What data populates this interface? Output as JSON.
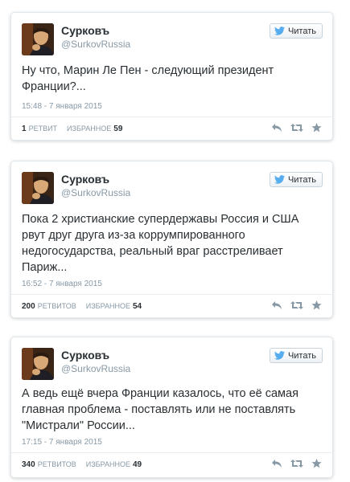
{
  "tweets": [
    {
      "name": "Сурковъ",
      "handle": "@SurkovRussia",
      "follow_label": "Читать",
      "text": "Ну что, Марин Ле Пен - следующий президент Франции?...",
      "time": "15:48 - 7 января 2015",
      "retweets_count": "1",
      "retweets_label": "ретвит",
      "favorites_label": "избранное",
      "favorites_count": "59"
    },
    {
      "name": "Сурковъ",
      "handle": "@SurkovRussia",
      "follow_label": "Читать",
      "text": "Пока 2 христианские супердержавы Россия и США рвут друг друга из-за коррумпированного недогосударства, реальный враг расстреливает Париж...",
      "time": "16:52 - 7 января 2015",
      "retweets_count": "200",
      "retweets_label": "ретвитов",
      "favorites_label": "избранное",
      "favorites_count": "54"
    },
    {
      "name": "Сурковъ",
      "handle": "@SurkovRussia",
      "follow_label": "Читать",
      "text": "А ведь ещё вчера Франции казалось, что её самая главная проблема - поставлять или не поставлять \"Мистрали\" России...",
      "time": "17:15 - 7 января 2015",
      "retweets_count": "340",
      "retweets_label": "ретвитов",
      "favorites_label": "избранное",
      "favorites_count": "49"
    }
  ],
  "colors": {
    "bird_blue": "#55acee",
    "icon_gray": "#8899a6",
    "text_dark": "#292f33",
    "muted": "#8899a6"
  }
}
